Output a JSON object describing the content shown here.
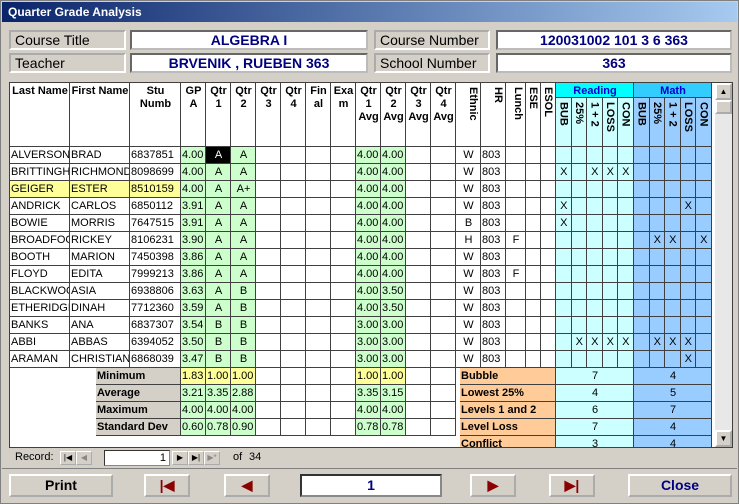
{
  "window_title": "Quarter Grade Analysis",
  "header": {
    "course_title_label": "Course Title",
    "course_title": "ALGEBRA I",
    "teacher_label": "Teacher",
    "teacher": "BRVENIK , RUEBEN 363",
    "course_number_label": "Course Number",
    "course_number": "120031002 101 3 6 363",
    "school_number_label": "School Number",
    "school_number": "363"
  },
  "columns": {
    "last": "Last Name",
    "first": "First Name",
    "stu": "Stu Numb",
    "gpa": "GP A",
    "q1": "Qtr 1",
    "q2": "Qtr 2",
    "q3": "Qtr 3",
    "q4": "Qtr 4",
    "final": "Fin al",
    "exam": "Exa m",
    "q1avg": "Qtr 1 Avg",
    "q2avg": "Qtr 2 Avg",
    "q3avg": "Qtr 3 Avg",
    "q4avg": "Qtr 4 Avg",
    "ethnic": "Ethnic",
    "hr": "HR",
    "lunch": "Lunch",
    "ese": "ESE",
    "esol": "ESOL",
    "reading": "Reading",
    "math": "Math",
    "sub": [
      "BUB",
      "25%",
      "1 + 2",
      "LOSS",
      "CON"
    ]
  },
  "rows": [
    {
      "last": "ALVERSON",
      "first": "BRAD",
      "stu": "6837851",
      "gpa": "4.00",
      "q1": "A",
      "q2": "A",
      "q1avg": "4.00",
      "q2avg": "4.00",
      "eth": "W",
      "hr": "803",
      "lunch": "",
      "r": [
        "",
        "",
        "",
        "",
        ""
      ],
      "m": [
        "",
        "",
        "",
        "",
        ""
      ]
    },
    {
      "last": "BRITTINGHAM",
      "first": "RICHMOND",
      "stu": "8098699",
      "gpa": "4.00",
      "q1": "A",
      "q2": "A",
      "q1avg": "4.00",
      "q2avg": "4.00",
      "eth": "W",
      "hr": "803",
      "lunch": "",
      "r": [
        "X",
        "",
        "X",
        "X",
        "X"
      ],
      "m": [
        "",
        "",
        "",
        "",
        ""
      ]
    },
    {
      "last": "GEIGER",
      "first": "ESTER",
      "stu": "8510159",
      "gpa": "4.00",
      "q1": "A",
      "q2": "A+",
      "q1avg": "4.00",
      "q2avg": "4.00",
      "eth": "W",
      "hr": "803",
      "lunch": "",
      "r": [
        "",
        "",
        "",
        "",
        ""
      ],
      "m": [
        "",
        "",
        "",
        "",
        ""
      ]
    },
    {
      "last": "ANDRICK",
      "first": "CARLOS",
      "stu": "6850112",
      "gpa": "3.91",
      "q1": "A",
      "q2": "A",
      "q1avg": "4.00",
      "q2avg": "4.00",
      "eth": "W",
      "hr": "803",
      "lunch": "",
      "r": [
        "X",
        "",
        "",
        "",
        ""
      ],
      "m": [
        "",
        "",
        "",
        "X",
        ""
      ]
    },
    {
      "last": "BOWIE",
      "first": "MORRIS",
      "stu": "7647515",
      "gpa": "3.91",
      "q1": "A",
      "q2": "A",
      "q1avg": "4.00",
      "q2avg": "4.00",
      "eth": "B",
      "hr": "803",
      "lunch": "",
      "r": [
        "X",
        "",
        "",
        "",
        ""
      ],
      "m": [
        "",
        "",
        "",
        "",
        ""
      ]
    },
    {
      "last": "BROADFOOT",
      "first": "RICKEY",
      "stu": "8106231",
      "gpa": "3.90",
      "q1": "A",
      "q2": "A",
      "q1avg": "4.00",
      "q2avg": "4.00",
      "eth": "H",
      "hr": "803",
      "lunch": "F",
      "r": [
        "",
        "",
        "",
        "",
        ""
      ],
      "m": [
        "",
        "X",
        "X",
        "",
        "X"
      ]
    },
    {
      "last": "BOOTH",
      "first": "MARION",
      "stu": "7450398",
      "gpa": "3.86",
      "q1": "A",
      "q2": "A",
      "q1avg": "4.00",
      "q2avg": "4.00",
      "eth": "W",
      "hr": "803",
      "lunch": "",
      "r": [
        "",
        "",
        "",
        "",
        ""
      ],
      "m": [
        "",
        "",
        "",
        "",
        ""
      ]
    },
    {
      "last": "FLOYD",
      "first": "EDITA",
      "stu": "7999213",
      "gpa": "3.86",
      "q1": "A",
      "q2": "A",
      "q1avg": "4.00",
      "q2avg": "4.00",
      "eth": "W",
      "hr": "803",
      "lunch": "F",
      "r": [
        "",
        "",
        "",
        "",
        ""
      ],
      "m": [
        "",
        "",
        "",
        "",
        ""
      ]
    },
    {
      "last": "BLACKWOOD",
      "first": "ASIA",
      "stu": "6938806",
      "gpa": "3.63",
      "q1": "A",
      "q2": "B",
      "q1avg": "4.00",
      "q2avg": "3.50",
      "eth": "W",
      "hr": "803",
      "lunch": "",
      "r": [
        "",
        "",
        "",
        "",
        ""
      ],
      "m": [
        "",
        "",
        "",
        "",
        ""
      ]
    },
    {
      "last": "ETHERIDGE",
      "first": "DINAH",
      "stu": "7712360",
      "gpa": "3.59",
      "q1": "A",
      "q2": "B",
      "q1avg": "4.00",
      "q2avg": "3.50",
      "eth": "W",
      "hr": "803",
      "lunch": "",
      "r": [
        "",
        "",
        "",
        "",
        ""
      ],
      "m": [
        "",
        "",
        "",
        "",
        ""
      ]
    },
    {
      "last": "BANKS",
      "first": "ANA",
      "stu": "6837307",
      "gpa": "3.54",
      "q1": "B",
      "q2": "B",
      "q1avg": "3.00",
      "q2avg": "3.00",
      "eth": "W",
      "hr": "803",
      "lunch": "",
      "r": [
        "",
        "",
        "",
        "",
        ""
      ],
      "m": [
        "",
        "",
        "",
        "",
        ""
      ]
    },
    {
      "last": "ABBI",
      "first": "ABBAS",
      "stu": "6394052",
      "gpa": "3.50",
      "q1": "B",
      "q2": "B",
      "q1avg": "3.00",
      "q2avg": "3.00",
      "eth": "W",
      "hr": "803",
      "lunch": "",
      "r": [
        "",
        "X",
        "X",
        "X",
        "X"
      ],
      "m": [
        "",
        "X",
        "X",
        "X",
        ""
      ]
    },
    {
      "last": "ARAMAN",
      "first": "CHRISTIAN",
      "stu": "6868039",
      "gpa": "3.47",
      "q1": "B",
      "q2": "B",
      "q1avg": "3.00",
      "q2avg": "3.00",
      "eth": "W",
      "hr": "803",
      "lunch": "",
      "r": [
        "",
        "",
        "",
        "",
        ""
      ],
      "m": [
        "",
        "",
        "",
        "X",
        ""
      ]
    }
  ],
  "stats": [
    {
      "label": "Minimum",
      "gpa": "1.83",
      "q1": "1.00",
      "q2": "1.00",
      "q1avg": "1.00",
      "q2avg": "1.00"
    },
    {
      "label": "Average",
      "gpa": "3.21",
      "q1": "3.35",
      "q2": "2.88",
      "q1avg": "3.35",
      "q2avg": "3.15"
    },
    {
      "label": "Maximum",
      "gpa": "4.00",
      "q1": "4.00",
      "q2": "4.00",
      "q1avg": "4.00",
      "q2avg": "4.00"
    },
    {
      "label": "Standard Dev",
      "gpa": "0.60",
      "q1": "0.78",
      "q2": "0.90",
      "q1avg": "0.78",
      "q2avg": "0.78"
    }
  ],
  "summary": [
    {
      "label": "Bubble",
      "reading": "7",
      "math": "4"
    },
    {
      "label": "Lowest 25%",
      "reading": "4",
      "math": "5"
    },
    {
      "label": "Levels 1 and 2",
      "reading": "6",
      "math": "7"
    },
    {
      "label": "Level Loss",
      "reading": "7",
      "math": "4"
    },
    {
      "label": "Conflict",
      "reading": "3",
      "math": "4"
    }
  ],
  "record_nav": {
    "label": "Record:",
    "current": "1",
    "of": "of",
    "total": "34"
  },
  "buttons": {
    "print": "Print",
    "page": "1",
    "close": "Close"
  }
}
